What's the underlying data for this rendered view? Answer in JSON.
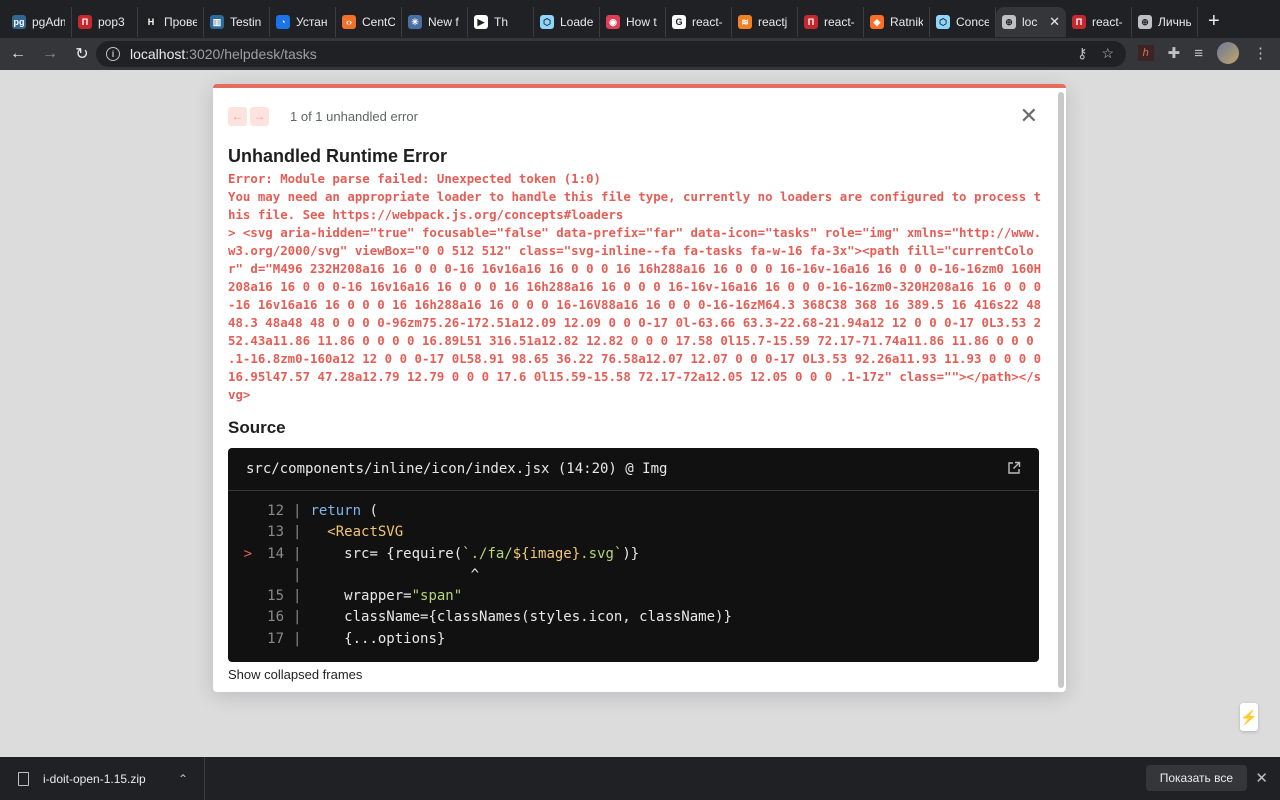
{
  "browser": {
    "tabs": [
      {
        "label": "pgAdmin",
        "color": "#336791",
        "glyph": "pg"
      },
      {
        "label": "pop3",
        "color": "#c5282f",
        "glyph": "П"
      },
      {
        "label": "Прове",
        "color": "#1f1f1f",
        "glyph": "H"
      },
      {
        "label": "Testin",
        "color": "#2b6a9b",
        "glyph": "▥"
      },
      {
        "label": "Устан",
        "color": "#1a73e8",
        "glyph": "◔"
      },
      {
        "label": "CentC",
        "color": "#f0712b",
        "glyph": "‹›"
      },
      {
        "label": "New f",
        "color": "#4a6fa5",
        "glyph": "✳"
      },
      {
        "label": "Th",
        "color": "#ffffff",
        "glyph": "▶"
      },
      {
        "label": "Loade",
        "color": "#8ed6fb",
        "glyph": "⬡"
      },
      {
        "label": "How t",
        "color": "#e03e57",
        "glyph": "◉"
      },
      {
        "label": "react-",
        "color": "#ffffff",
        "glyph": "G"
      },
      {
        "label": "reactj",
        "color": "#f48024",
        "glyph": "≋"
      },
      {
        "label": "react-",
        "color": "#c5282f",
        "glyph": "П"
      },
      {
        "label": "Ratnik",
        "color": "#fc6d26",
        "glyph": "◆"
      },
      {
        "label": "Conce",
        "color": "#8ed6fb",
        "glyph": "⬡"
      },
      {
        "label": "loc",
        "color": "#bdc1c6",
        "glyph": "⊕",
        "active": true
      },
      {
        "label": "react-",
        "color": "#c5282f",
        "glyph": "П"
      },
      {
        "label": "Личнь",
        "color": "#bdc1c6",
        "glyph": "⊕"
      }
    ],
    "new_tab_glyph": "+",
    "url_host": "localhost",
    "url_path": ":3020/helpdesk/tasks"
  },
  "overlay": {
    "pager_text": "1 of 1 unhandled error",
    "title": "Unhandled Runtime Error",
    "error_message": "Error: Module parse failed: Unexpected token (1:0)\nYou may need an appropriate loader to handle this file type, currently no loaders are configured to process this file. See https://webpack.js.org/concepts#loaders\n> <svg aria-hidden=\"true\" focusable=\"false\" data-prefix=\"far\" data-icon=\"tasks\" role=\"img\" xmlns=\"http://www.w3.org/2000/svg\" viewBox=\"0 0 512 512\" class=\"svg-inline--fa fa-tasks fa-w-16 fa-3x\"><path fill=\"currentColor\" d=\"M496 232H208a16 16 0 0 0-16 16v16a16 16 0 0 0 16 16h288a16 16 0 0 0 16-16v-16a16 16 0 0 0-16-16zm0 160H208a16 16 0 0 0-16 16v16a16 16 0 0 0 16 16h288a16 16 0 0 0 16-16v-16a16 16 0 0 0-16-16zm0-320H208a16 16 0 0 0-16 16v16a16 16 0 0 0 16 16h288a16 16 0 0 0 16-16V88a16 16 0 0 0-16-16zM64.3 368C38 368 16 389.5 16 416s22 48 48.3 48a48 48 0 0 0 0-96zm75.26-172.51a12.09 12.09 0 0 0-17 0l-63.66 63.3-22.68-21.94a12 12 0 0 0-17 0L3.53 252.43a11.86 11.86 0 0 0 0 16.89L51 316.51a12.82 12.82 0 0 0 17.58 0l15.7-15.59 72.17-71.74a11.86 11.86 0 0 0 .1-16.8zm0-160a12 12 0 0 0-17 0L58.91 98.65 36.22 76.58a12.07 12.07 0 0 0-17 0L3.53 92.26a11.93 11.93 0 0 0 0 16.95l47.57 47.28a12.79 12.79 0 0 0 17.6 0l15.59-15.58 72.17-72a12.05 12.05 0 0 0 .1-17z\" class=\"\"></path></svg>",
    "source_heading": "Source",
    "source_file": "src/components/inline/icon/index.jsx (14:20) @ Img",
    "code_lines": [
      {
        "num": "12",
        "text": "return ("
      },
      {
        "num": "13",
        "text": "  <ReactSVG"
      },
      {
        "num": "14",
        "text": "    src= {require(`./fa/${image}.svg`)}",
        "marker": ">"
      },
      {
        "num": "",
        "text": "                   ^"
      },
      {
        "num": "15",
        "text": "    wrapper=\"span\""
      },
      {
        "num": "16",
        "text": "    className={classNames(styles.icon, className)}"
      },
      {
        "num": "17",
        "text": "    {...options}"
      }
    ],
    "show_collapsed_label": "Show collapsed frames"
  },
  "downloads": {
    "file_name": "i-doit-open-1.15.zip",
    "show_all_label": "Показать все"
  },
  "colors": {
    "accent_error": "#e65d55",
    "chrome_dark": "#202124",
    "chrome_toolbar": "#35363a"
  }
}
